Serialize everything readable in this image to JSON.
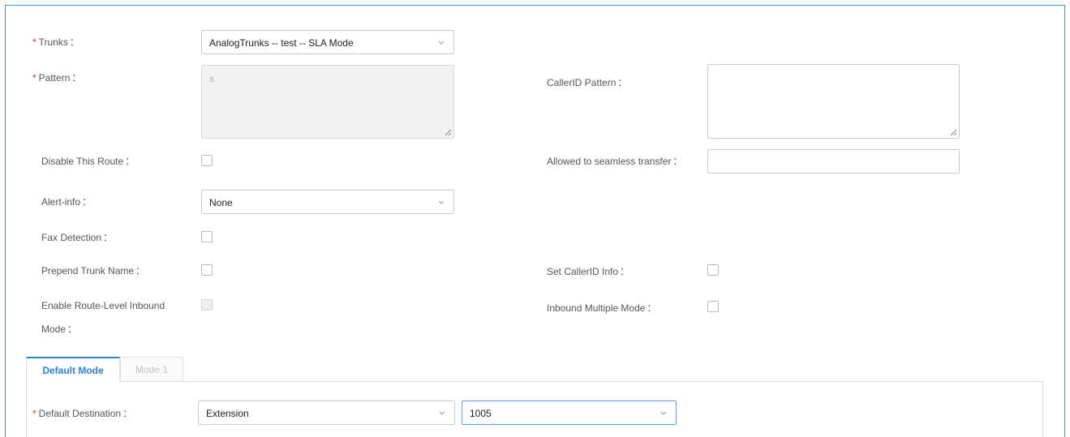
{
  "form": {
    "trunks": {
      "label": "Trunks",
      "value": "AnalogTrunks -- test -- SLA Mode",
      "required": "*"
    },
    "pattern": {
      "label": "Pattern",
      "placeholder": "s",
      "required": "*"
    },
    "callerid_pattern": {
      "label": "CallerID Pattern",
      "value": ""
    },
    "disable_route": {
      "label": "Disable This Route",
      "checked": false
    },
    "seamless_transfer": {
      "label": "Allowed to seamless transfer",
      "value": ""
    },
    "alert_info": {
      "label": "Alert-info",
      "value": "None"
    },
    "fax_detection": {
      "label": "Fax Detection",
      "checked": false
    },
    "prepend_trunk_name": {
      "label": "Prepend Trunk Name",
      "checked": false
    },
    "set_callerid_info": {
      "label": "Set CallerID Info",
      "checked": false
    },
    "route_level_inbound": {
      "label_line1": "Enable Route-Level Inbound",
      "label_line2": "Mode",
      "checked": false
    },
    "inbound_multiple_mode": {
      "label": "Inbound Multiple Mode",
      "checked": false
    }
  },
  "colon": "：",
  "tabs": [
    {
      "label": "Default Mode",
      "active": true
    },
    {
      "label": "Mode 1",
      "active": false
    }
  ],
  "default_destination": {
    "label": "Default Destination",
    "required": "*",
    "type_value": "Extension",
    "target_value": "1005"
  },
  "colors": {
    "accent": "#2f7fd9",
    "required": "#e0312a",
    "frame_border": "#4a90d9"
  },
  "icons": {
    "dropdown": "chevron-down-icon",
    "resize": "resize-grip-icon"
  }
}
